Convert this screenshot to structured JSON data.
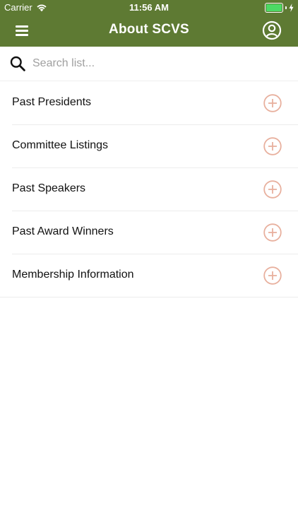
{
  "status_bar": {
    "carrier": "Carrier",
    "time": "11:56 AM",
    "signal_icon": "wifi-icon",
    "battery_icon": "battery-icon",
    "charging_icon": "charging-bolt-icon"
  },
  "header": {
    "title": "About SCVS",
    "menu_icon": "hamburger-menu-icon",
    "profile_icon": "user-profile-icon",
    "background_color": "#5e7a33"
  },
  "search": {
    "placeholder": "Search list...",
    "value": "",
    "icon": "search-icon"
  },
  "list": {
    "items": [
      {
        "label": "Past Presidents"
      },
      {
        "label": "Committee Listings"
      },
      {
        "label": "Past Speakers"
      },
      {
        "label": "Past Award Winners"
      },
      {
        "label": "Membership Information"
      }
    ],
    "expand_icon": "plus-circle-icon",
    "accent_color": "#e8b09e"
  }
}
